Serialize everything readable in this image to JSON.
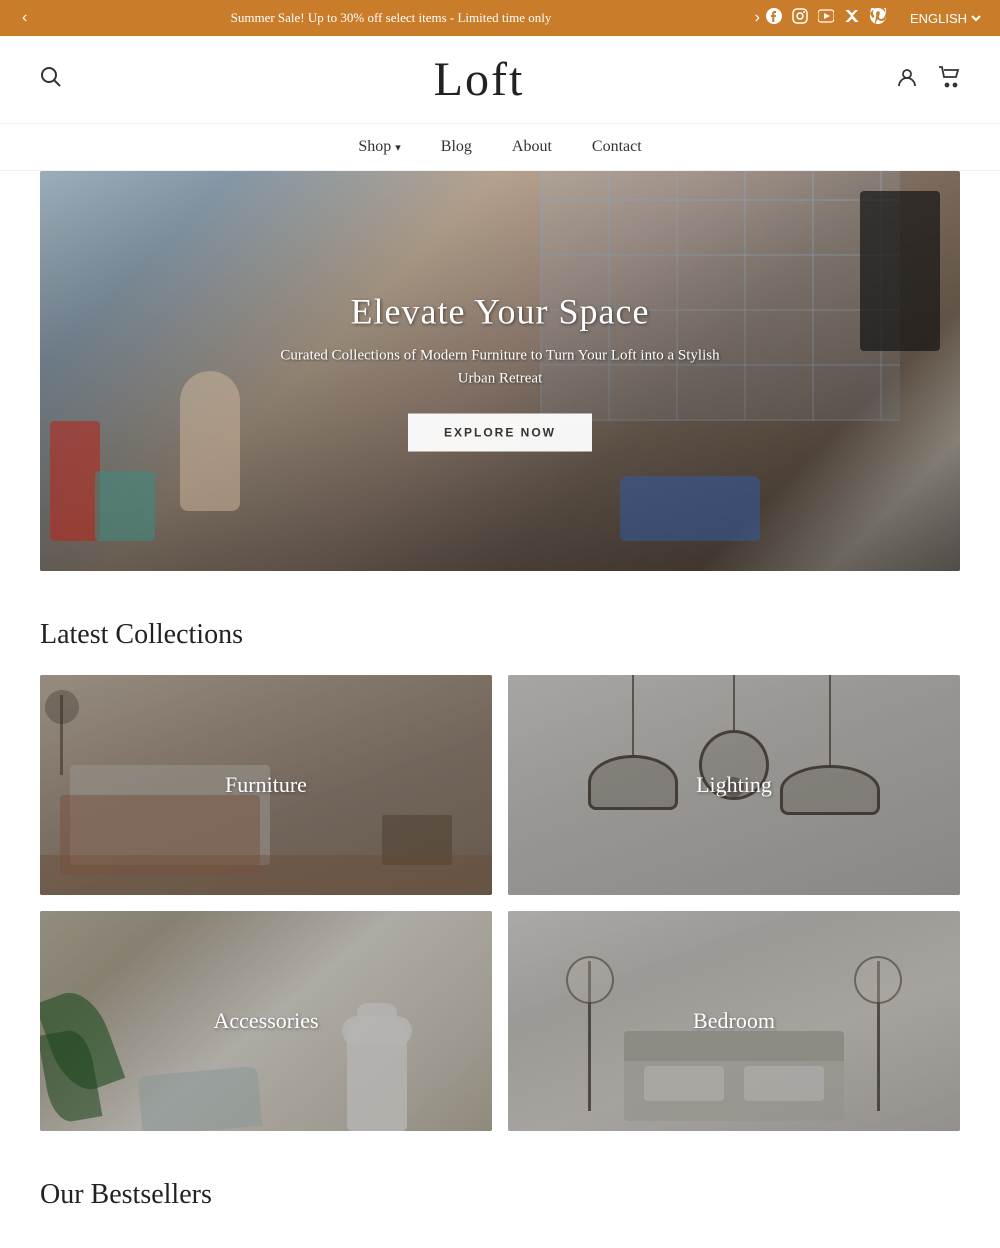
{
  "announcement": {
    "text": "Summer Sale! Up to 30% off select items - Limited time only",
    "prev_arrow": "‹",
    "next_arrow": "›",
    "lang": "ENGLISH ▾"
  },
  "social": [
    {
      "name": "facebook-icon",
      "symbol": "f"
    },
    {
      "name": "instagram-icon",
      "symbol": "◉"
    },
    {
      "name": "youtube-icon",
      "symbol": "▶"
    },
    {
      "name": "twitter-icon",
      "symbol": "𝕏"
    },
    {
      "name": "pinterest-icon",
      "symbol": "𝕡"
    }
  ],
  "header": {
    "logo": "Loft",
    "search_icon": "🔍",
    "account_icon": "👤",
    "cart_icon": "🛒"
  },
  "nav": {
    "items": [
      {
        "label": "Shop",
        "has_dropdown": true
      },
      {
        "label": "Blog",
        "has_dropdown": false
      },
      {
        "label": "About",
        "has_dropdown": false
      },
      {
        "label": "Contact",
        "has_dropdown": false
      }
    ]
  },
  "hero": {
    "title": "Elevate Your Space",
    "subtitle": "Curated Collections of Modern Furniture to Turn Your Loft\ninto a Stylish Urban Retreat",
    "cta_label": "EXPLORE NOW"
  },
  "latest_collections": {
    "section_title": "Latest Collections",
    "items": [
      {
        "label": "Furniture",
        "category": "furniture"
      },
      {
        "label": "Lighting",
        "category": "lighting"
      },
      {
        "label": "Accessories",
        "category": "accessories"
      },
      {
        "label": "Bedroom",
        "category": "bedroom"
      }
    ]
  },
  "bestsellers": {
    "section_title": "Our Bestsellers"
  }
}
